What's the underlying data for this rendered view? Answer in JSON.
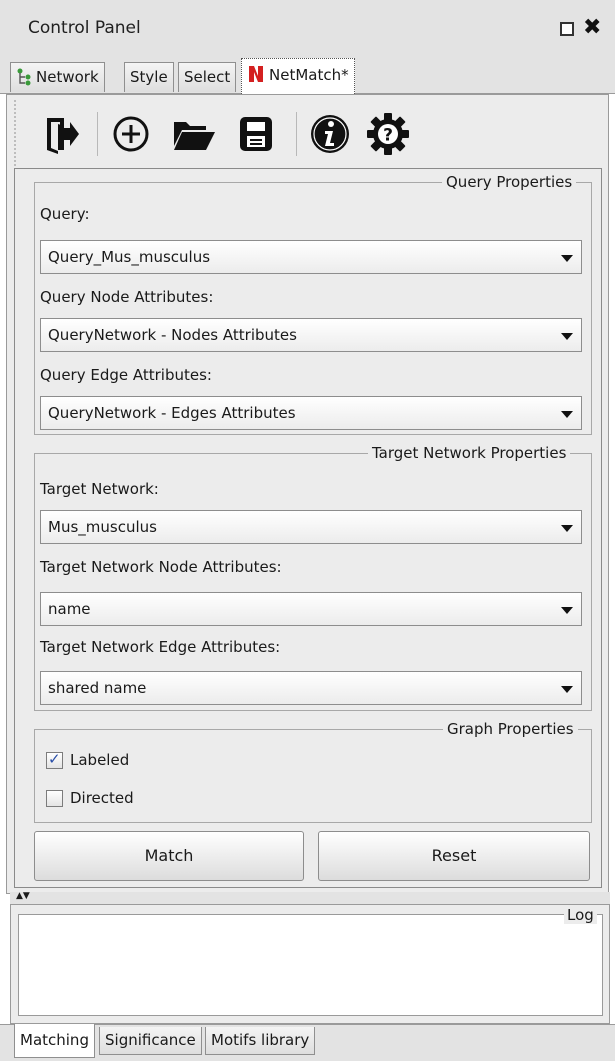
{
  "window": {
    "title": "Control Panel"
  },
  "top_tabs": [
    {
      "label": "Network",
      "icon": "network-tree-icon"
    },
    {
      "label": "Style"
    },
    {
      "label": "Select"
    },
    {
      "label": "NetMatch*",
      "icon": "netmatch-logo-icon",
      "active": true
    }
  ],
  "toolbar": {
    "icons": [
      "exit-icon",
      "add-circle-icon",
      "open-folder-icon",
      "save-disk-icon",
      "info-icon",
      "help-gear-icon"
    ]
  },
  "query_properties": {
    "title": "Query Properties",
    "query_label": "Query:",
    "query_value": "Query_Mus_musculus",
    "node_attr_label": "Query Node Attributes:",
    "node_attr_value": "QueryNetwork - Nodes Attributes",
    "edge_attr_label": "Query Edge Attributes:",
    "edge_attr_value": "QueryNetwork - Edges Attributes"
  },
  "target_properties": {
    "title": "Target Network Properties",
    "network_label": "Target Network:",
    "network_value": "Mus_musculus",
    "node_attr_label": "Target Network Node Attributes:",
    "node_attr_value": "name",
    "edge_attr_label": "Target Network Edge Attributes:",
    "edge_attr_value": "shared name"
  },
  "graph_properties": {
    "title": "Graph Properties",
    "labeled_label": "Labeled",
    "labeled_checked": true,
    "directed_label": "Directed",
    "directed_checked": false
  },
  "buttons": {
    "match": "Match",
    "reset": "Reset"
  },
  "log": {
    "title": "Log"
  },
  "bottom_tabs": [
    {
      "label": "Matching",
      "active": true
    },
    {
      "label": "Significance"
    },
    {
      "label": "Motifs library"
    }
  ],
  "colors": {
    "panel_bg": "#ececec",
    "netmatch_icon": "#d42020",
    "checkbox_mark": "#2a4fa8"
  }
}
